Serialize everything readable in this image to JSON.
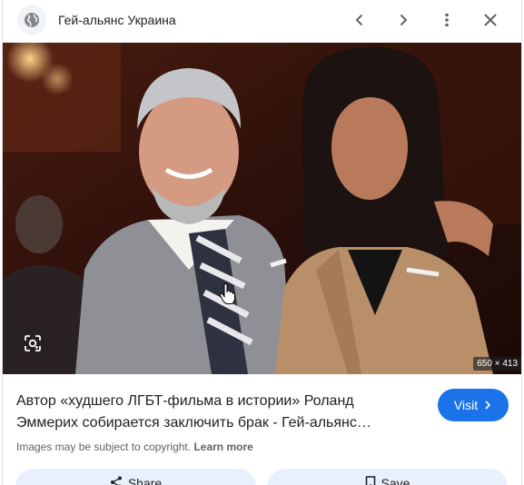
{
  "header": {
    "site_icon": "globe-icon",
    "site_name": "Гей-альянс Украина",
    "prev_icon": "chevron-left-icon",
    "next_icon": "chevron-right-icon",
    "more_icon": "more-vert-icon",
    "close_icon": "close-icon"
  },
  "image": {
    "dimensions_label": "650 × 413",
    "lens_icon": "lens-icon"
  },
  "result": {
    "title_line1": "Автор «худшего ЛГБТ-фильма в истории» Роланд",
    "title_line2": "Эммерих собирается заключить брак - Гей-альянс…",
    "visit_label": "Visit",
    "copyright_text": "Images may be subject to copyright.",
    "learn_more": "Learn more"
  },
  "actions": {
    "share_label": "Share",
    "save_label": "Save",
    "share_icon": "share-icon",
    "save_icon": "bookmark-icon"
  },
  "colors": {
    "accent": "#1a73e8",
    "action_bg": "#e8f0fe",
    "text_primary": "#202124",
    "text_secondary": "#5f6368"
  }
}
